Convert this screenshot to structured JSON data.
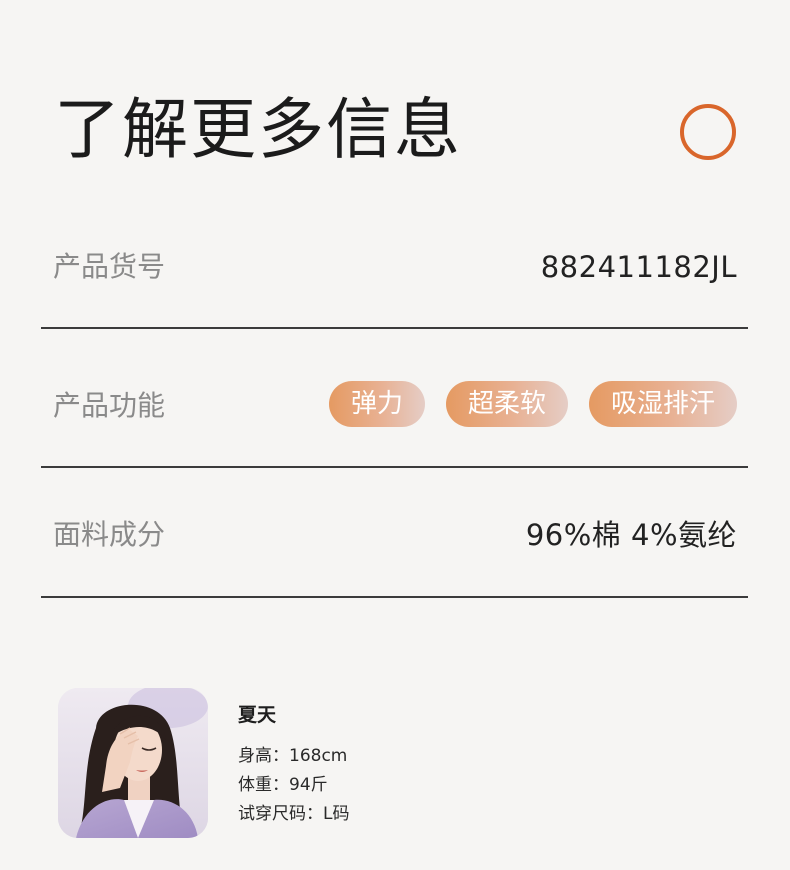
{
  "header": {
    "title": "了解更多信息"
  },
  "icons": {
    "ring": "circle-outline-icon"
  },
  "colors": {
    "background": "#f6f5f3",
    "accent": "#d9662b",
    "tag_gradient_start": "#e59a62",
    "tag_gradient_end": "#e5cdc6",
    "divider": "#3b3b3b"
  },
  "info": {
    "sku": {
      "label": "产品货号",
      "value": "882411182JL"
    },
    "function": {
      "label": "产品功能",
      "tags": [
        "弹力",
        "超柔软",
        "吸湿排汗"
      ]
    },
    "fabric": {
      "label": "面料成分",
      "value": "96%棉 4%氨纶"
    }
  },
  "model": {
    "name": "夏天",
    "height": "身高：168cm",
    "weight": "体重：94斤",
    "size": "试穿尺码：L码"
  }
}
